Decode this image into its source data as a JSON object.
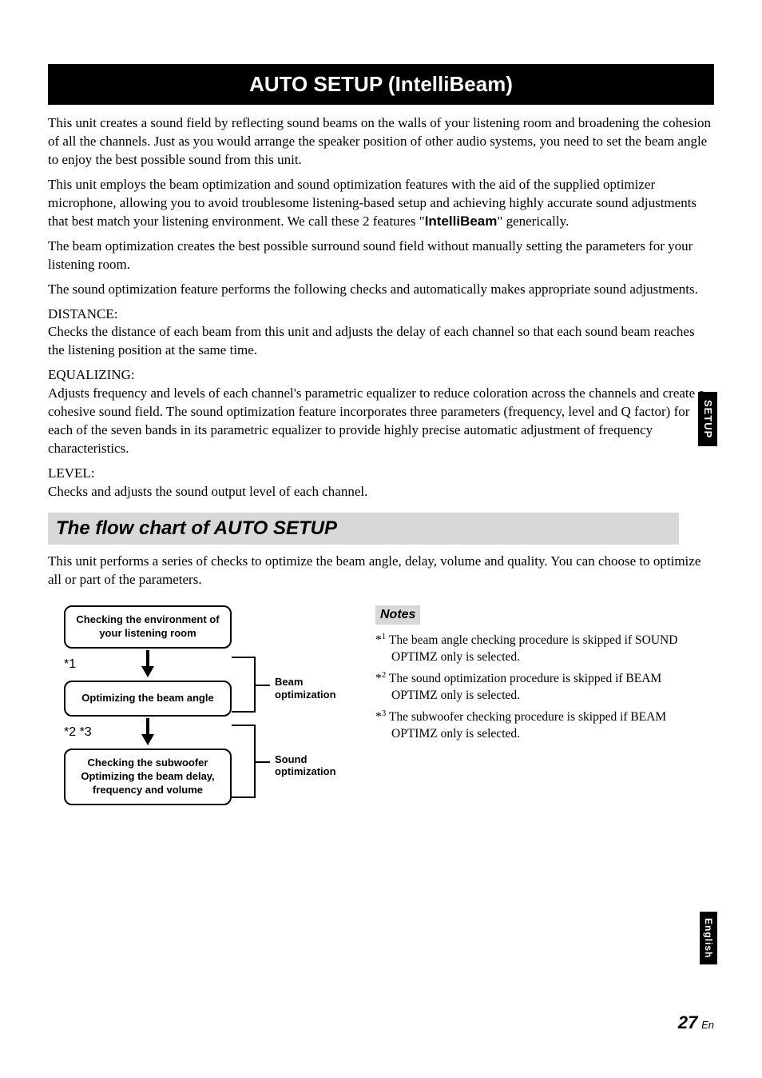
{
  "title": "AUTO SETUP (IntelliBeam)",
  "intro1": "This unit creates a sound field by reflecting sound beams on the walls of your listening room and broadening the cohesion of all the channels. Just as you would arrange the speaker position of other audio systems, you need to set the beam angle to enjoy the best possible sound from this unit.",
  "intro2a": "This unit employs the beam optimization and sound optimization features with the aid of the supplied optimizer microphone, allowing you to avoid troublesome listening-based setup and achieving highly accurate sound adjustments that best match your listening environment. We call these 2 features \"",
  "intro2b": "IntelliBeam",
  "intro2c": "\" generically.",
  "intro3": "The beam optimization creates the best possible surround sound field without manually setting the parameters for your listening room.",
  "intro4": "The sound optimization feature performs the following checks and automatically makes appropriate sound adjustments.",
  "distance": {
    "label": "DISTANCE:",
    "text": "Checks the distance of each beam from this unit and adjusts the delay of each channel so that each sound beam reaches the listening position at the same time."
  },
  "equalizing": {
    "label": "EQUALIZING:",
    "text": "Adjusts frequency and levels of each channel's parametric equalizer to reduce coloration across the channels and create a cohesive sound field. The sound optimization feature incorporates three parameters (frequency, level and Q factor) for each of the seven bands in its parametric equalizer to provide highly precise automatic adjustment of frequency characteristics."
  },
  "level": {
    "label": "LEVEL:",
    "text": "Checks and adjusts the sound output level of each channel."
  },
  "section_header": "The flow chart of AUTO SETUP",
  "flow_intro": "This unit performs a series of checks to optimize the beam angle, delay, volume and quality. You can choose to optimize all or part of the parameters.",
  "flow": {
    "box1": "Checking the environment of your listening room",
    "ast1": "*1",
    "box2": "Optimizing the beam angle",
    "ast2": "*2 *3",
    "box3": "Checking the subwoofer Optimizing the beam delay, frequency and volume",
    "bracket1": "Beam optimization",
    "bracket2": "Sound optimization"
  },
  "notes": {
    "header": "Notes",
    "n1a": "*",
    "n1b": " The beam angle checking procedure is skipped if SOUND OPTIMZ only is selected.",
    "n2a": "*",
    "n2b": " The sound optimization procedure is skipped if BEAM OPTIMZ only is selected.",
    "n3a": "*",
    "n3b": " The subwoofer checking procedure is skipped if BEAM OPTIMZ only is selected."
  },
  "tabs": {
    "setup": "SETUP",
    "english": "English"
  },
  "pagenum": {
    "num": "27",
    "lang": "En"
  }
}
